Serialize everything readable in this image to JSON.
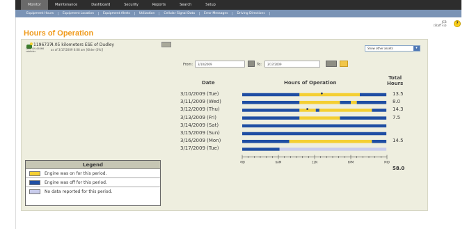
{
  "nav": {
    "tabs": [
      "Monitor",
      "Maintenance",
      "Dashboard",
      "Security",
      "Reports",
      "Search",
      "Setup"
    ]
  },
  "subnav": {
    "items": [
      "Equipment Hours",
      "Equipment Location",
      "Equipment Alerts",
      "Utilization",
      "Cellular Signal Data",
      "Error Messages",
      "Driving Directions"
    ]
  },
  "page": {
    "title": "Hours of Operation",
    "user_line1": "JCB",
    "user_line2": "(Staff v3)"
  },
  "asset": {
    "id": "1196737",
    "sub": "LDS. SN 45866\ncabfoler",
    "location": "4.05 kilometers ESE of Dudley",
    "location_sub": "as of 3/17/2009 6:08 am [Older (3%)]",
    "other_assets_select": "Show other assets"
  },
  "filters": {
    "from_label": "From:",
    "from_value": "3/10/2009",
    "to_label": "To:",
    "to_value": "3/17/2009"
  },
  "table": {
    "date_header": "Date",
    "hours_header": "Hours of Operation",
    "total_header": "Total\nHours",
    "grand_total": "58.0"
  },
  "legend": {
    "title": "Legend",
    "on": "Engine was on for this period.",
    "off": "Engine was off for this period.",
    "none": "No data reported for this period."
  },
  "colors": {
    "on": "#f4cf33",
    "off": "#1f4ea3",
    "none": "#c9ccec"
  },
  "chart_data": {
    "type": "bar",
    "orientation": "horizontal-timeline",
    "x_ticks": [
      "MID",
      "6AM",
      "12N",
      "6PM",
      "MID"
    ],
    "rows": [
      {
        "date": "3/10/2009 (Tue)",
        "total": "13.5",
        "segments": [
          [
            "off",
            0,
            9.5
          ],
          [
            "on",
            9.5,
            19.5
          ],
          [
            "off",
            19.5,
            23.9
          ]
        ]
      },
      {
        "date": "3/11/2009 (Wed)",
        "total": "8.0",
        "segments": [
          [
            "off",
            0,
            9.5
          ],
          [
            "on",
            9.5,
            16.2
          ],
          [
            "off",
            16.2,
            18
          ],
          [
            "on",
            18,
            19
          ],
          [
            "off",
            19,
            23.9
          ]
        ]
      },
      {
        "date": "3/12/2009 (Thu)",
        "total": "14.3",
        "segments": [
          [
            "off",
            0,
            9.5
          ],
          [
            "on",
            9.5,
            12.2
          ],
          [
            "off",
            12.2,
            12.8
          ],
          [
            "on",
            12.8,
            21.5
          ],
          [
            "off",
            21.5,
            23.9
          ]
        ]
      },
      {
        "date": "3/13/2009   (Fri)",
        "total": "7.5",
        "segments": [
          [
            "off",
            0,
            9.5
          ],
          [
            "on",
            9.5,
            16.2
          ],
          [
            "off",
            16.2,
            23.9
          ]
        ]
      },
      {
        "date": "3/14/2009  (Sat)",
        "total": "",
        "segments": [
          [
            "off",
            0,
            23.9
          ]
        ]
      },
      {
        "date": "3/15/2009  (Sun)",
        "total": "",
        "segments": [
          [
            "off",
            0,
            23.9
          ]
        ]
      },
      {
        "date": "3/16/2009 (Mon)",
        "total": "14.5",
        "segments": [
          [
            "off",
            0,
            7.8
          ],
          [
            "on",
            7.8,
            21.5
          ],
          [
            "off",
            21.5,
            23.9
          ]
        ]
      },
      {
        "date": "3/17/2009 (Tue)",
        "total": "",
        "segments": [
          [
            "off",
            0,
            6.2
          ],
          [
            "none",
            6.2,
            23.9
          ]
        ]
      }
    ]
  }
}
